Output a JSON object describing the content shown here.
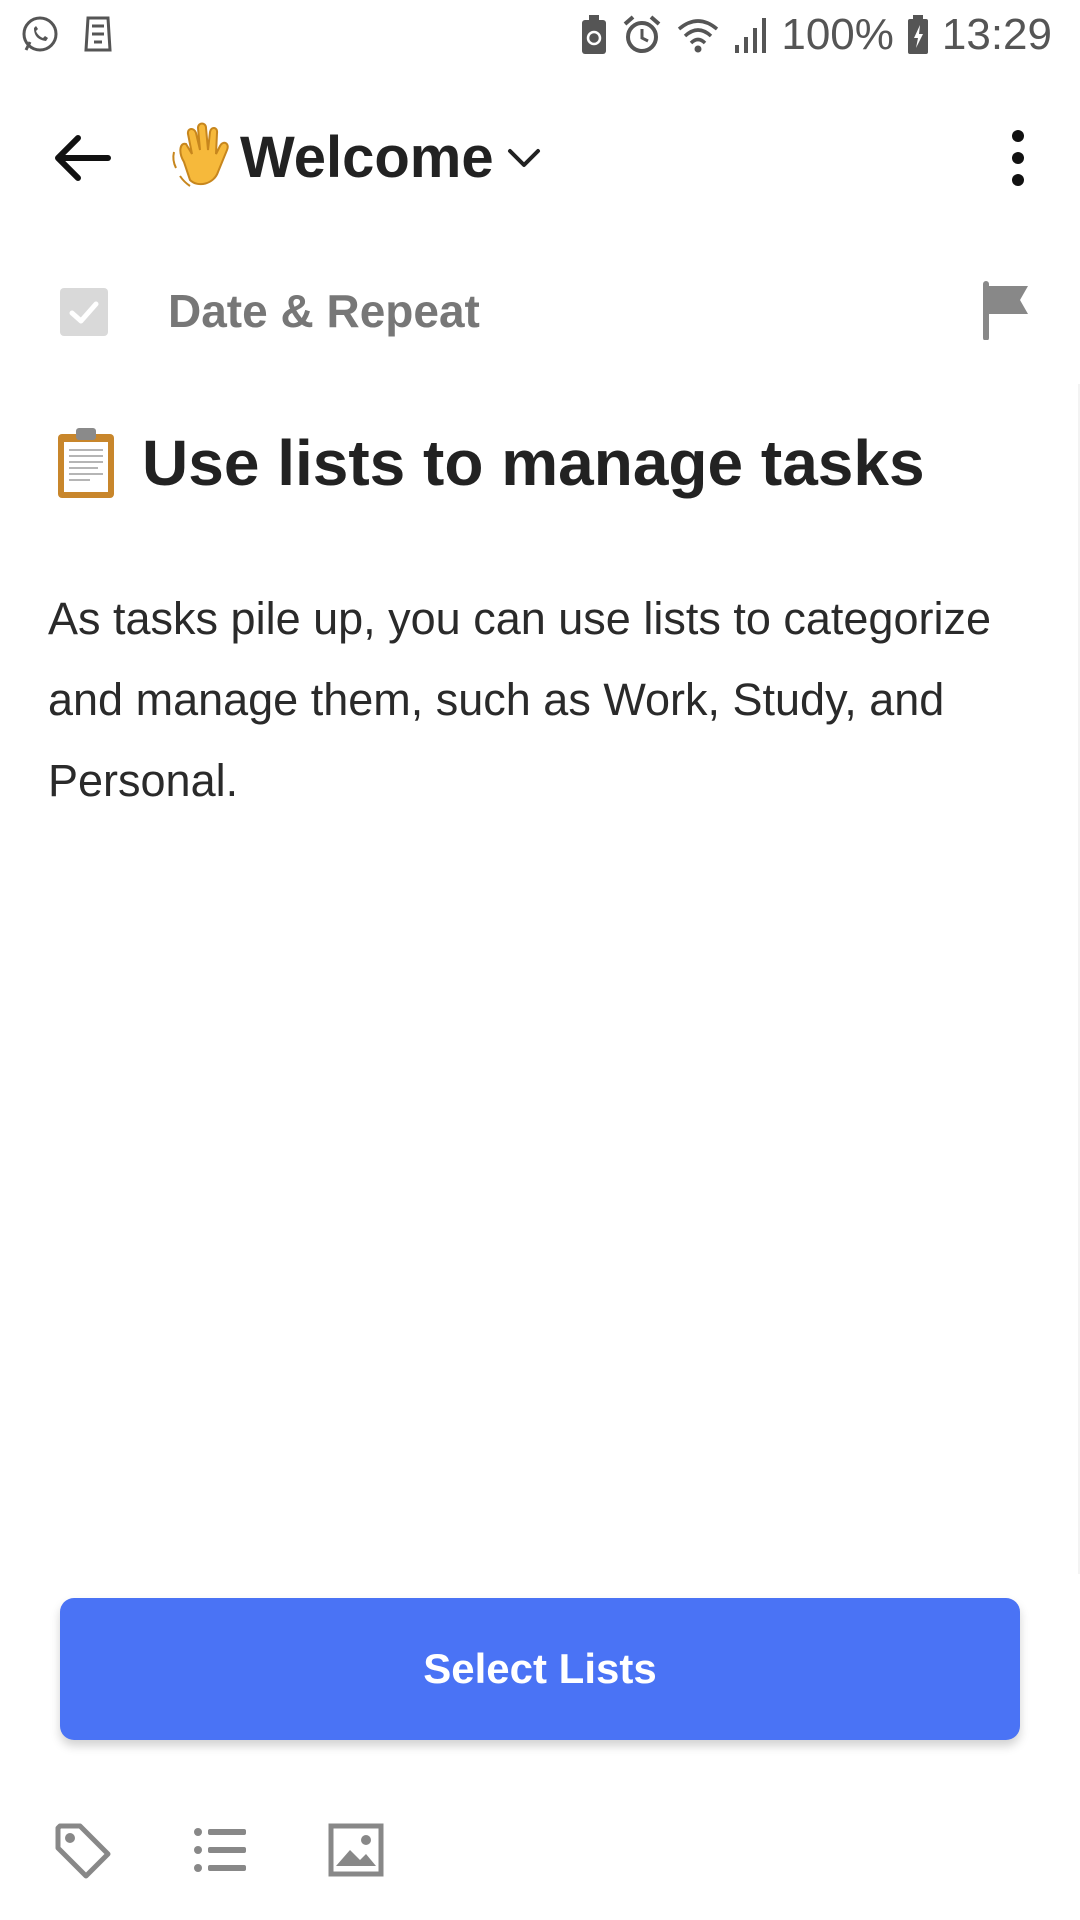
{
  "status_bar": {
    "battery": "100%",
    "time": "13:29",
    "icons": [
      "whatsapp-icon",
      "app-icon",
      "battery-saver-icon",
      "alarm-icon",
      "wifi-icon",
      "signal-icon",
      "battery-charging-icon"
    ]
  },
  "toolbar": {
    "title": "Welcome",
    "title_emoji": "waving-hand-icon",
    "back_icon": "back-arrow-icon",
    "more_icon": "more-vert-icon"
  },
  "meta": {
    "date_label": "Date & Repeat",
    "checked": true,
    "flag_icon": "flag-icon"
  },
  "content": {
    "title": "Use lists to manage tasks",
    "title_emoji": "clipboard-icon",
    "body": "As tasks pile up, you can use lists to categorize and manage them, such as Work, Study, and Personal."
  },
  "action": {
    "label": "Select Lists",
    "color": "#4a73f5"
  },
  "bottom_toolbar": {
    "icons": [
      "tag-icon",
      "list-icon",
      "image-icon"
    ]
  }
}
